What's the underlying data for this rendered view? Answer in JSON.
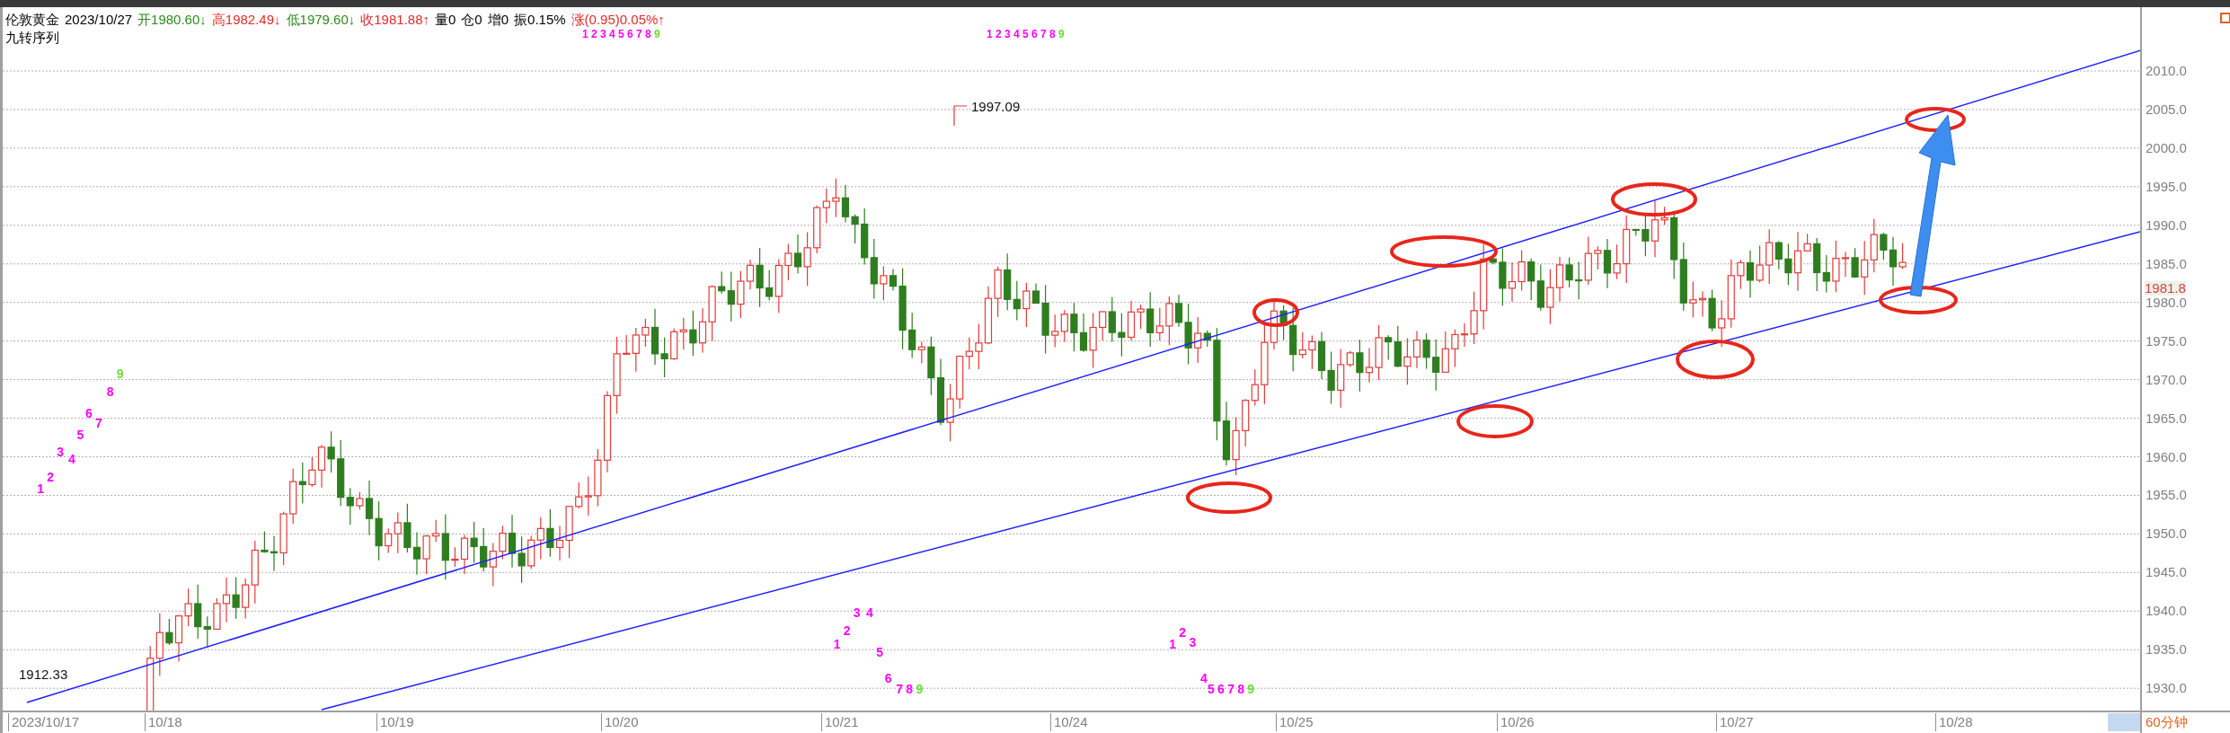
{
  "header": {
    "symbol": "伦敦黄金",
    "date": "2023/10/27",
    "quote": [
      {
        "text": "开1980.60↓",
        "color": "#2f8a1f"
      },
      {
        "text": "高1982.49↓",
        "color": "#e52a2a"
      },
      {
        "text": "低1979.60↓",
        "color": "#2f8a1f"
      },
      {
        "text": "收1981.88↑",
        "color": "#e52a2a"
      },
      {
        "text": "量0",
        "color": "#000000"
      },
      {
        "text": "仓0",
        "color": "#000000"
      },
      {
        "text": "增0",
        "color": "#000000"
      },
      {
        "text": "振0.15%",
        "color": "#000000"
      },
      {
        "text": "涨(0.95)0.05%↑",
        "color": "#e52a2a"
      }
    ]
  },
  "indicator": {
    "name": "九转序列"
  },
  "chart": {
    "annotations": [
      "1997.09",
      "1912.33"
    ],
    "sequences": [
      [
        {
          "text": "1",
          "color": "#ff00ff"
        },
        {
          "text": "2",
          "color": "#ff00ff"
        },
        {
          "text": "3",
          "color": "#ff00ff"
        },
        {
          "text": "4",
          "color": "#ff00ff"
        },
        {
          "text": "5",
          "color": "#ff00ff"
        },
        {
          "text": "6",
          "color": "#ff00ff"
        },
        {
          "text": "7",
          "color": "#ff00ff"
        },
        {
          "text": "8",
          "color": "#ff00ff"
        },
        {
          "text": "9",
          "color": "#66dd33"
        }
      ],
      [
        {
          "text": "1",
          "color": "#ff00ff"
        },
        {
          "text": "2",
          "color": "#ff00ff"
        },
        {
          "text": "3",
          "color": "#ff00ff"
        },
        {
          "text": "4",
          "color": "#ff00ff"
        },
        {
          "text": "5",
          "color": "#ff00ff"
        },
        {
          "text": "6",
          "color": "#ff00ff"
        },
        {
          "text": "7",
          "color": "#ff00ff"
        },
        {
          "text": "8",
          "color": "#ff00ff"
        },
        {
          "text": "9",
          "color": "#66dd33"
        }
      ],
      [
        {
          "text": "1",
          "color": "#ff00ff"
        },
        {
          "text": "2",
          "color": "#ff00ff"
        },
        {
          "text": "3",
          "color": "#ff00ff"
        },
        {
          "text": "4",
          "color": "#ff00ff"
        },
        {
          "text": "5",
          "color": "#ff00ff"
        },
        {
          "text": "6",
          "color": "#ff00ff"
        },
        {
          "text": "7",
          "color": "#ff00ff"
        },
        {
          "text": "8",
          "color": "#ff00ff"
        },
        {
          "text": "9",
          "color": "#66dd33"
        }
      ],
      [
        {
          "text": "1",
          "color": "#ff00ff"
        },
        {
          "text": "2",
          "color": "#ff00ff"
        },
        {
          "text": "3",
          "color": "#ff00ff"
        },
        {
          "text": "4",
          "color": "#ff00ff"
        },
        {
          "text": "5",
          "color": "#ff00ff"
        },
        {
          "text": "6",
          "color": "#ff00ff"
        },
        {
          "text": "7",
          "color": "#ff00ff"
        },
        {
          "text": "8",
          "color": "#ff00ff"
        },
        {
          "text": "9",
          "color": "#66dd33"
        }
      ],
      [
        {
          "text": "1",
          "color": "#ff00ff"
        },
        {
          "text": "2",
          "color": "#ff00ff"
        },
        {
          "text": "3",
          "color": "#ff00ff"
        },
        {
          "text": "4",
          "color": "#ff00ff"
        },
        {
          "text": "5",
          "color": "#ff00ff"
        },
        {
          "text": "6",
          "color": "#ff00ff"
        },
        {
          "text": "7",
          "color": "#ff00ff"
        },
        {
          "text": "8",
          "color": "#ff00ff"
        },
        {
          "text": "9",
          "color": "#66dd33"
        }
      ]
    ]
  },
  "price_axis": {
    "labels": [
      "2010.0",
      "2005.0",
      "2000.0",
      "1995.0",
      "1990.0",
      "1985.0",
      "1980.0",
      "1975.0",
      "1970.0",
      "1965.0",
      "1960.0",
      "1955.0",
      "1950.0",
      "1945.0",
      "1940.0",
      "1935.0",
      "1930.0"
    ],
    "current_price": "1981.8"
  },
  "date_axis": {
    "labels": [
      "2023/10/17",
      "10/18",
      "10/19",
      "10/20",
      "10/21",
      "10/24",
      "10/25",
      "10/26",
      "10/27",
      "10/28"
    ]
  },
  "period": "60分钟"
}
